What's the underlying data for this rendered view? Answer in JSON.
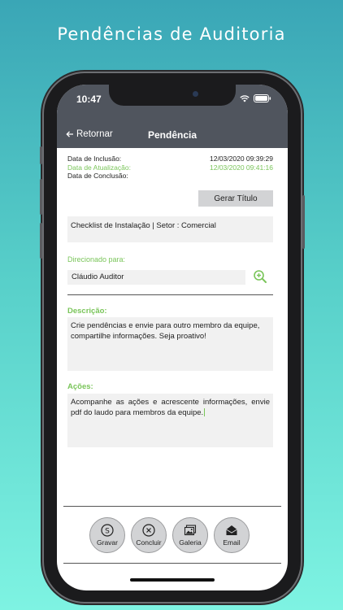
{
  "promo": {
    "headline": "Pendências de Auditoria"
  },
  "status_bar": {
    "time": "10:47"
  },
  "nav": {
    "back_label": "Retornar",
    "title": "Pendência"
  },
  "meta": {
    "inclusao_label": "Data de Inclusão:",
    "inclusao_value": "12/03/2020 09:39:29",
    "atualizacao_label": "Data de Atualização:",
    "atualizacao_value": "12/03/2020 09:41:16",
    "conclusao_label": "Data de Conclusão:",
    "conclusao_value": ""
  },
  "gerar_titulo": {
    "label": "Gerar Título"
  },
  "checklist": {
    "value": "Checklist de Instalação | Setor : Comercial"
  },
  "direcionado": {
    "label": "Direcionado para:",
    "value": "Cláudio Auditor"
  },
  "descricao": {
    "label": "Descrição:",
    "value": "Crie pendências e envie para outro membro da equipe, compartilhe informações. Seja proativo!"
  },
  "acoes": {
    "label": "Ações:",
    "value": "Acompanhe as ações e acrescente informações, envie pdf do laudo para membros da equipe."
  },
  "toolbar": {
    "items": [
      {
        "label": "Gravar",
        "icon": "save-icon"
      },
      {
        "label": "Concluir",
        "icon": "close-circle-icon"
      },
      {
        "label": "Galeria",
        "icon": "gallery-icon"
      },
      {
        "label": "Email",
        "icon": "email-icon"
      }
    ]
  },
  "colors": {
    "accent_green": "#7ac55a",
    "header_gray": "#50555e",
    "field_bg": "#f1f1f1",
    "button_gray": "#d2d3d5"
  }
}
